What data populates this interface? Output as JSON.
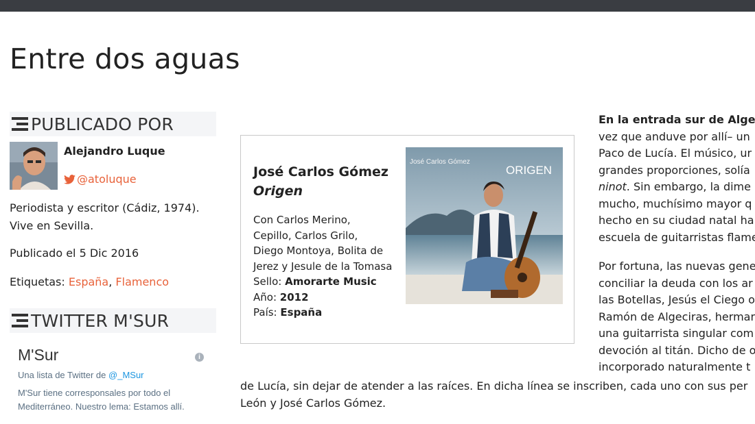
{
  "page": {
    "title": "Entre dos aguas"
  },
  "sidebar": {
    "published_by": {
      "heading": "PUBLICADO POR",
      "author_name": "Alejandro Luque",
      "twitter_handle": "@atoluque",
      "bio_line1": "Periodista y escritor (Cádiz, 1974).",
      "bio_line2": "Vive en Sevilla.",
      "published_date": "Publicado el 5 Dic 2016",
      "tags_label": "Etiquetas:",
      "tags": [
        "España",
        "Flamenco"
      ],
      "tags_separator": ","
    },
    "twitter_msur": {
      "heading": "TWITTER M'SUR",
      "widget_title": "M'Sur",
      "info_icon": "i",
      "list_prefix": "Una lista de Twitter de",
      "list_owner": "@_MSur",
      "desc_line1": "M'Sur tiene corresponsales por todo el",
      "desc_line2": "Mediterráneo. Nuestro lema: Estamos allí."
    }
  },
  "album": {
    "artist": "José Carlos Gómez",
    "name": "Origen",
    "credits": [
      "Con Carlos Merino,",
      "Cepillo, Carlos Grilo,",
      "Diego Montoya, Bolita de",
      "Jerez y Jesule de la Tomasa"
    ],
    "label_key": "Sello:",
    "label_value": "Amorarte Music",
    "year_key": "Año:",
    "year_value": "2012",
    "country_key": "País:",
    "country_value": "España",
    "cover_artist": "José Carlos Gómez",
    "cover_title": "ORIGEN"
  },
  "article": {
    "p1_lead": "En la entrada sur de Algec",
    "p1_lines": [
      "vez que anduve por allí– un",
      "Paco de Lucía. El músico, ur",
      "grandes proporciones, solía",
      "ninot",
      ". Sin embargo, la dime",
      "mucho, muchísimo mayor q",
      "hecho en su ciudad natal ha",
      "escuela de guitarristas flame"
    ],
    "p2_lines": [
      "Por fortuna, las nuevas gene",
      "conciliar la deuda con los ar",
      "las Botellas, Jesús el Ciego o",
      "Ramón de Algeciras, herman",
      "una guitarrista singular com",
      "devoción al titán. Dicho de o",
      "incorporado naturalmente t",
      "de Lucía, sin dejar de atender a las raíces. En dicha línea se inscriben, cada uno con sus per",
      "León y José Carlos Gómez."
    ]
  },
  "colors": {
    "topbar": "#3a3d42",
    "accent": "#e8623a",
    "twitter_blue": "#1b95e0"
  }
}
